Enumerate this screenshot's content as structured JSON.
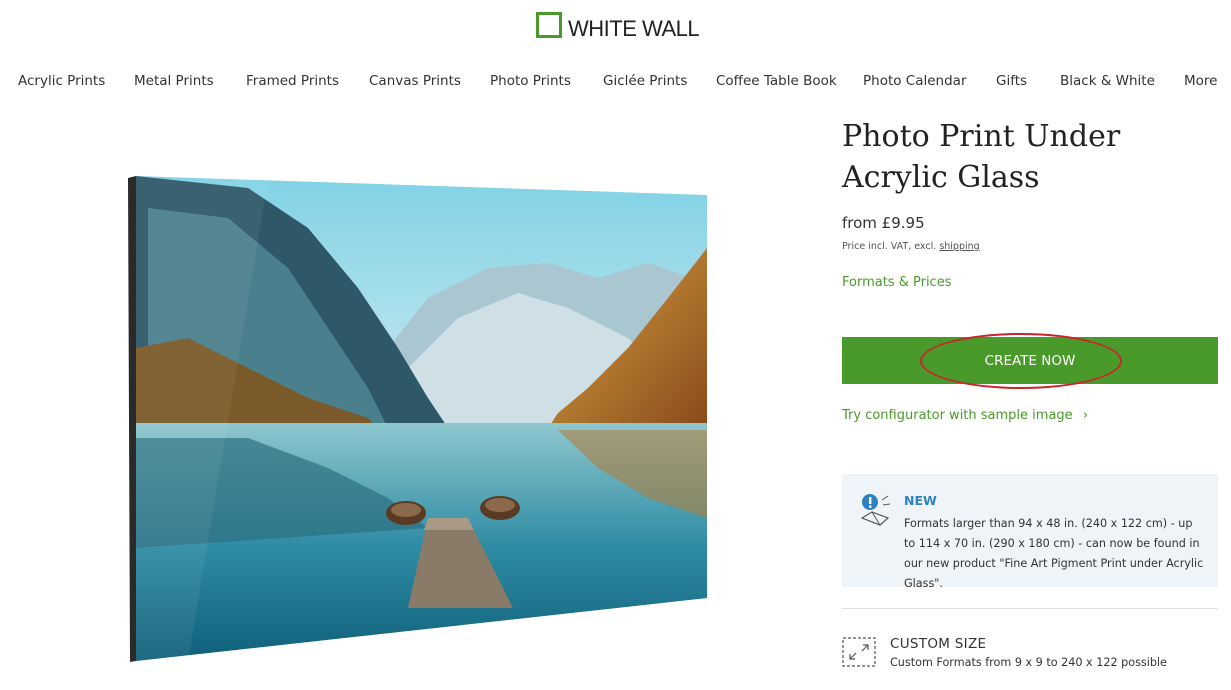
{
  "header": {
    "logo_text": "WHITE WALL"
  },
  "nav": {
    "items": [
      {
        "label": "Acrylic Prints"
      },
      {
        "label": "Metal Prints"
      },
      {
        "label": "Framed Prints"
      },
      {
        "label": "Canvas Prints"
      },
      {
        "label": "Photo Prints"
      },
      {
        "label": "Giclée Prints"
      },
      {
        "label": "Coffee Table Book"
      },
      {
        "label": "Photo Calendar"
      },
      {
        "label": "Gifts"
      },
      {
        "label": "Black & White"
      },
      {
        "label": "More"
      }
    ]
  },
  "product": {
    "title": "Photo Print Under Acrylic Glass",
    "price": "from £9.95",
    "price_note_prefix": "Price incl. VAT, excl.",
    "price_note_link": "shipping",
    "formats_link": "Formats & Prices",
    "cta_label": "CREATE NOW",
    "try_link": "Try configurator with sample image",
    "try_chevron": "›"
  },
  "info": {
    "badge": "NEW",
    "text": "Formats larger than 94 x 48 in. (240 x 122 cm) - up to 114 x 70 in. (290 x 180 cm) - can now be found in our new product \"Fine Art Pigment Print under Acrylic Glass\"."
  },
  "custom_size": {
    "title": "CUSTOM SIZE",
    "subtitle": "Custom Formats from 9 x 9 to 240 x 122 possible"
  },
  "colors": {
    "brand_green": "#4a9a2b",
    "info_blue": "#2f82c2",
    "annotation_red": "#c8262a",
    "info_bg": "#eef4f8"
  },
  "icons": {
    "logo": "square-outline-logo-icon",
    "info": "exclamation-new-icon",
    "custom_size": "resize-arrows-icon",
    "chevron": "chevron-right-icon"
  }
}
